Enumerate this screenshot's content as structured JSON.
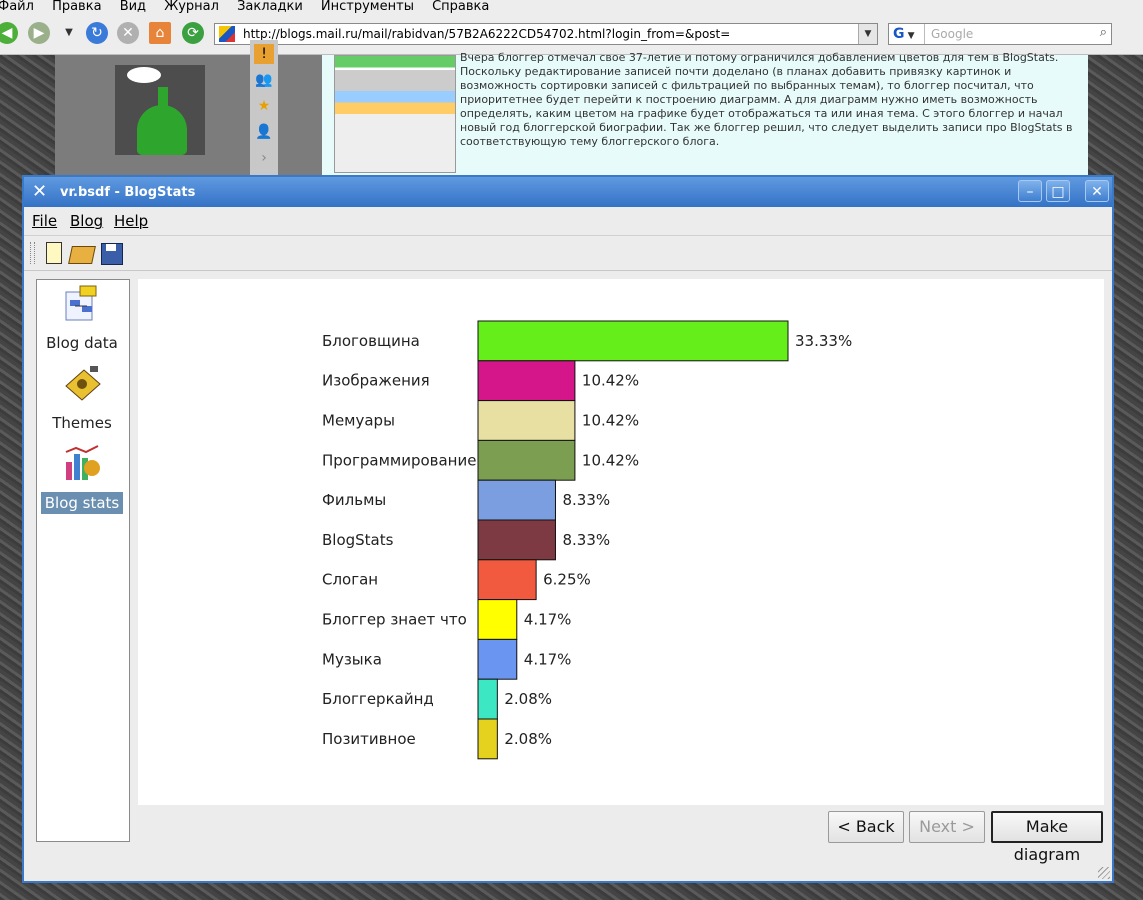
{
  "browser": {
    "menu": [
      "Файл",
      "Правка",
      "Вид",
      "Журнал",
      "Закладки",
      "Инструменты",
      "Справка"
    ],
    "url": "http://blogs.mail.ru/mail/rabidvan/57B2A6222CD54702.html?login_from=&post=",
    "search_placeholder": "Google",
    "search_engine_letter": "G"
  },
  "article": {
    "text": "Вчера блоггер отмечал свое 37-летие и потому ограничился добавлением цветов для тем в BlogStats. Поскольку редактирование записей почти доделано (в планах добавить привязку картинок и возможность сортировки записей с фильтрацией по выбранных темам), то блоггер посчитал, что приоритетнее будет перейти к построению диаграмм. А для диаграмм нужно иметь возможность определять, каким цветом на графике будет отображаться та или иная тема. С этого блоггер и начал новый год блоггерской биографии. Так же блоггер решил, что следует выделить записи про BlogStats в соответствующую тему блоггерского блога."
  },
  "window": {
    "title": "vr.bsdf - BlogStats",
    "menu": {
      "file": "File",
      "blog": "Blog",
      "help": "Help"
    }
  },
  "nav": {
    "items": [
      {
        "label": "Blog data",
        "icon": "blog-data-icon"
      },
      {
        "label": "Themes",
        "icon": "themes-icon"
      },
      {
        "label": "Blog stats",
        "icon": "blog-stats-icon",
        "selected": true
      }
    ]
  },
  "buttons": {
    "back": "< Back",
    "next": "Next >",
    "make_diagram": "Make diagram"
  },
  "chart_data": {
    "type": "bar",
    "orientation": "horizontal",
    "categories": [
      "Блоговщина",
      "Изображения",
      "Мемуары",
      "Программирование",
      "Фильмы",
      "BlogStats",
      "Слоган",
      "Блоггер знает что",
      "Музыка",
      "Блоггеркайнд",
      "Позитивное"
    ],
    "values": [
      33.33,
      10.42,
      10.42,
      10.42,
      8.33,
      8.33,
      6.25,
      4.17,
      4.17,
      2.08,
      2.08
    ],
    "value_labels": [
      "33.33%",
      "10.42%",
      "10.42%",
      "10.42%",
      "8.33%",
      "8.33%",
      "6.25%",
      "4.17%",
      "4.17%",
      "2.08%",
      "2.08%"
    ],
    "colors": [
      "#66ee1a",
      "#d4168a",
      "#e8e0a2",
      "#7b9e50",
      "#7a9ee0",
      "#7e3a42",
      "#f25a40",
      "#ffff00",
      "#6a96f2",
      "#3ce8c4",
      "#e4d21e"
    ],
    "xlim": [
      0,
      33.33
    ],
    "grid": false,
    "legend": "none"
  }
}
